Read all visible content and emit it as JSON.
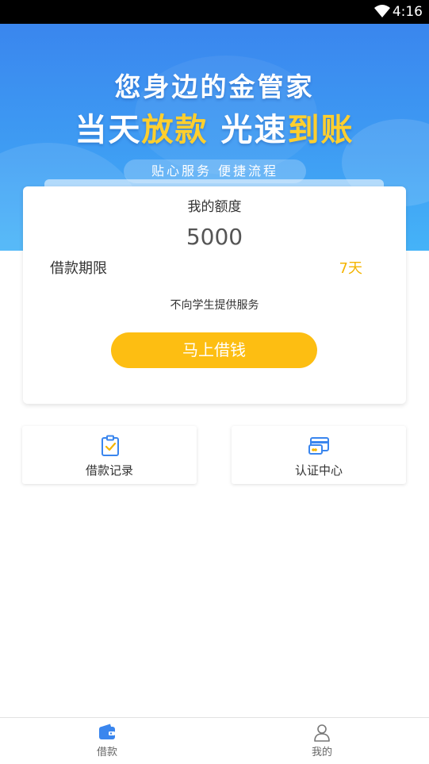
{
  "status_bar": {
    "time": "4:16",
    "wifi_icon": "wifi-icon"
  },
  "banner": {
    "headline_line1": "您身边的金管家",
    "headline_line2_a": "当天",
    "headline_line2_b": "放款",
    "headline_line2_c": "光速",
    "headline_line2_d": "到账",
    "tagline": "贴心服务 便捷流程",
    "accent_color": "#ffcf2e",
    "background_color": "#3e9cf3"
  },
  "quota_card": {
    "title": "我的额度",
    "amount": "5000",
    "term_label": "借款期限",
    "term_value": "7天",
    "notice": "不向学生提供服务",
    "cta_label": "马上借钱",
    "cta_color": "#fdbe12"
  },
  "shortcuts": [
    {
      "label": "借款记录",
      "icon": "clipboard-check-icon"
    },
    {
      "label": "认证中心",
      "icon": "card-icon"
    }
  ],
  "tabbar": {
    "tabs": [
      {
        "label": "借款",
        "icon": "wallet-icon",
        "active": true
      },
      {
        "label": "我的",
        "icon": "user-icon",
        "active": false
      }
    ],
    "active_color": "#3a86ee"
  }
}
